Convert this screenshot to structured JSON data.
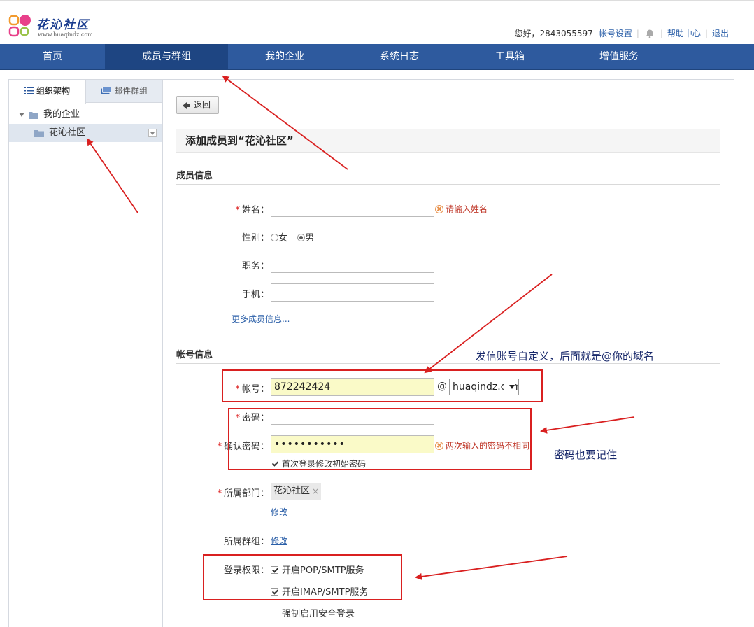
{
  "brand": {
    "title": "花沁社区",
    "url": "www.huaqindz.com",
    "colors": {
      "pink": "#e8408a",
      "orange": "#f29a2e",
      "blue": "#1a3c8f",
      "nav": "#2e5a9e",
      "nav_active": "#1e4582"
    }
  },
  "topbar": {
    "greeting": "您好，2843055597",
    "account_settings": "帐号设置",
    "notification_icon": "bell-icon",
    "help": "帮助中心",
    "logout": "退出"
  },
  "nav": {
    "items": [
      {
        "label": "首页"
      },
      {
        "label": "成员与群组"
      },
      {
        "label": "我的企业"
      },
      {
        "label": "系统日志"
      },
      {
        "label": "工具箱"
      },
      {
        "label": "增值服务"
      }
    ],
    "active": "成员与群组"
  },
  "sidebar": {
    "tabs": [
      {
        "label": "组织架构",
        "icon": "list-icon"
      },
      {
        "label": "邮件群组",
        "icon": "mail-group-icon"
      }
    ],
    "tree": {
      "root": "我的企业",
      "child": "花沁社区"
    }
  },
  "main": {
    "back": "返回",
    "title": "添加成员到“花沁社区”",
    "member_section": "成员信息",
    "name_label": "姓名：",
    "name_error": "请输入姓名",
    "gender_label": "性别：",
    "gender_female": "女",
    "gender_male": "男",
    "gender_selected": "男",
    "position_label": "职务：",
    "phone_label": "手机：",
    "more_info": "更多成员信息...",
    "account_section": "帐号信息",
    "account_label": "帐号：",
    "account_value": "872242424",
    "at": "@",
    "domain_value": "huaqindz.com",
    "password_label": "密码：",
    "confirm_label": "确认密码：",
    "confirm_value": "•••••••••••",
    "confirm_error": "两次输入的密码不相同",
    "first_login_change": "首次登录修改初始密码",
    "dept_label": "所属部门：",
    "dept_value": "花沁社区",
    "dept_remove": "×",
    "modify": "修改",
    "group_label": "所属群组：",
    "group_modify": "修改",
    "perm_label": "登录权限：",
    "pop_smtp": "开启POP/SMTP服务",
    "imap_smtp": "开启IMAP/SMTP服务",
    "secure_login": "强制启用安全登录",
    "required_mark": "*"
  },
  "annotations": {
    "account_note": "发信账号自定义，后面就是@你的域名",
    "password_note": "密码也要记住",
    "annotation_color": "#d92020"
  }
}
